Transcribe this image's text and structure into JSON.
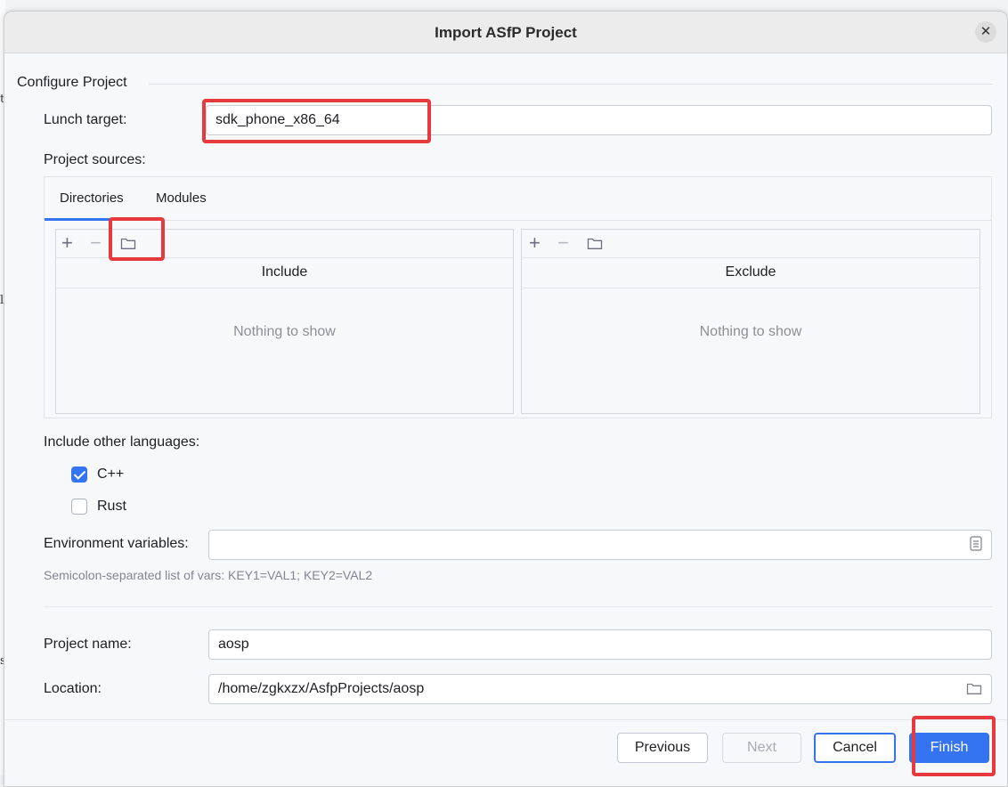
{
  "window": {
    "title": "Import ASfP Project"
  },
  "section": {
    "title": "Configure Project"
  },
  "launch_target": {
    "label": "Lunch target:",
    "value": "sdk_phone_x86_64"
  },
  "sources": {
    "label": "Project sources:",
    "tabs": [
      {
        "label": "Directories",
        "selected": true
      },
      {
        "label": "Modules",
        "selected": false
      }
    ],
    "include": {
      "header": "Include",
      "empty": "Nothing to show"
    },
    "exclude": {
      "header": "Exclude",
      "empty": "Nothing to show"
    },
    "toolbar_icons": [
      "add-icon",
      "remove-icon",
      "folder-icon"
    ]
  },
  "languages": {
    "label": "Include other languages:",
    "options": [
      {
        "label": "C++",
        "checked": true
      },
      {
        "label": "Rust",
        "checked": false
      }
    ]
  },
  "env": {
    "label": "Environment variables:",
    "value": "",
    "hint": "Semicolon-separated list of vars: KEY1=VAL1; KEY2=VAL2"
  },
  "project_name": {
    "label": "Project name:",
    "value": "aosp"
  },
  "location": {
    "label": "Location:",
    "value": "/home/zgkxzx/AsfpProjects/aosp"
  },
  "buttons": {
    "previous": "Previous",
    "next": "Next",
    "cancel": "Cancel",
    "finish": "Finish"
  },
  "colors": {
    "accent": "#3574f0",
    "highlight": "#e63a3e"
  }
}
